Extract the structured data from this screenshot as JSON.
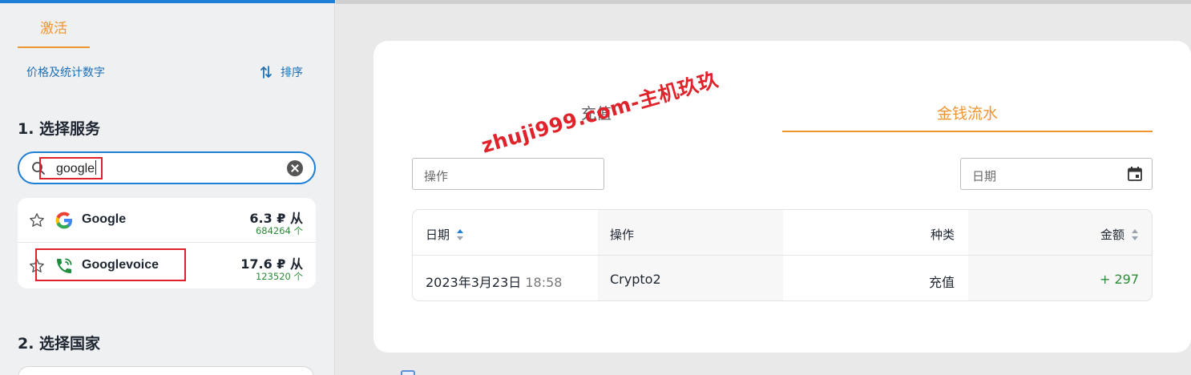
{
  "sidebar": {
    "active_tab": "激活",
    "price_stats_link": "价格及统计数字",
    "sort_label": "排序",
    "step1_title": "1. 选择服务",
    "search": {
      "value": "google"
    },
    "results": [
      {
        "name": "Google",
        "price": "6.3 ₽ 从",
        "count": "684264 个",
        "logo": "google-logo-icon"
      },
      {
        "name": "Googlevoice",
        "price": "17.6 ₽ 从",
        "count": "123520 个",
        "logo": "phone-call-icon"
      }
    ],
    "step2_title": "2. 选择国家"
  },
  "main": {
    "tabs": [
      {
        "label": "充值",
        "active": false
      },
      {
        "label": "金钱流水",
        "active": true
      }
    ],
    "filters": {
      "operation_placeholder": "操作",
      "date_placeholder": "日期"
    },
    "table": {
      "headers": [
        "日期",
        "操作",
        "种类",
        "金额"
      ],
      "rows": [
        {
          "date": "2023年3月23日",
          "time": "18:58",
          "operation": "Crypto2",
          "type": "充值",
          "amount": "+ 297"
        }
      ]
    }
  },
  "watermark": "zhuji999.com-主机玖玖",
  "colors": {
    "accent_orange": "#f0952e",
    "link_blue": "#1f6fb5",
    "positive_green": "#2e8b3a",
    "highlight_red": "#e0232b"
  }
}
